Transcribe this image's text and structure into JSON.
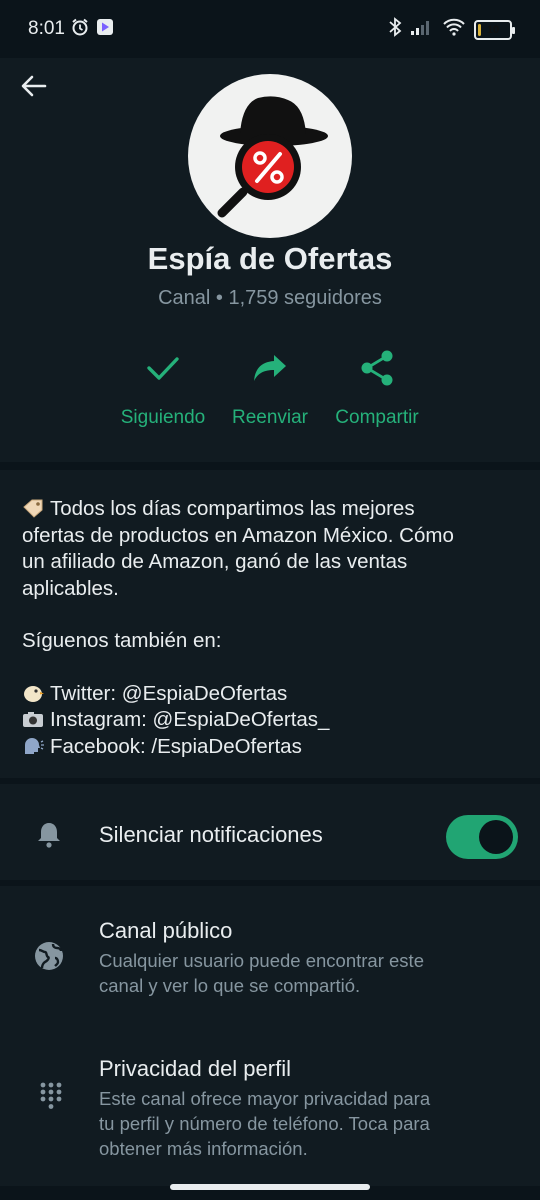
{
  "status": {
    "time": "8:01",
    "battery": "10"
  },
  "channel": {
    "name": "Espía de Ofertas",
    "meta": "Canal • 1,759 seguidores"
  },
  "actions": [
    {
      "label": "Siguiendo",
      "icon": "check-icon"
    },
    {
      "label": "Reenviar",
      "icon": "forward-icon"
    },
    {
      "label": "Compartir",
      "icon": "share-icon"
    }
  ],
  "description": {
    "lines": [
      "Todos los días compartimos las mejores",
      "ofertas de productos en Amazon México. Cómo",
      "un afiliado de Amazon, ganó de las ventas",
      "aplicables."
    ],
    "follow": "Síguenos también en:",
    "social": [
      "Twitter: @EspiaDeOfertas",
      "Instagram: @EspiaDeOfertas_",
      "Facebook: /EspiaDeOfertas"
    ]
  },
  "mute": {
    "label": "Silenciar notificaciones",
    "enabled": true
  },
  "settings": [
    {
      "title": "Canal público",
      "desc_lines": [
        "Cualquier usuario puede encontrar este",
        "canal y ver lo que se compartió."
      ]
    },
    {
      "title": "Privacidad del perfil",
      "desc_lines": [
        "Este canal ofrece mayor privacidad para",
        "tu perfil y número de teléfono. Toca para",
        "obtener más información."
      ]
    }
  ],
  "colors": {
    "accent": "#25b17a",
    "background": "#0b141a",
    "panel": "#111b21",
    "secondary_text": "#8696a0"
  }
}
